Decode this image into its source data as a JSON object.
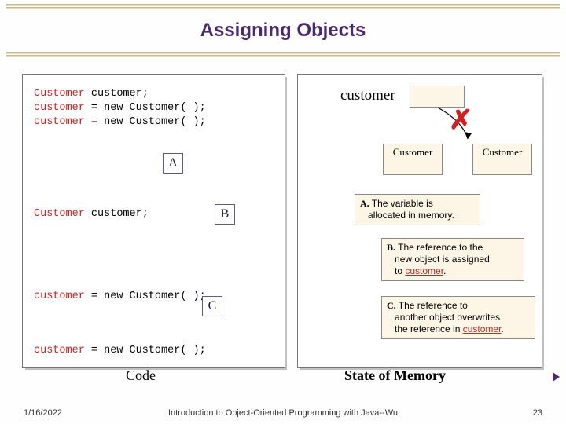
{
  "title": "Assigning Objects",
  "code_top": {
    "l1a": "Customer",
    "l1b": " customer;",
    "l2a": "customer",
    "l2b": " = new Customer( );",
    "l3a": "customer",
    "l3b": " = new Customer( );"
  },
  "badges": {
    "a": "A",
    "b": "B",
    "c": "C"
  },
  "code_bottom": {
    "l1a": "Customer",
    "l1b": " customer;",
    "l2a": "customer",
    "l2b": " = new Customer( );",
    "l3a": "customer",
    "l3b": " = new Customer( );"
  },
  "memory": {
    "var_label": "customer",
    "obj1": "Customer",
    "obj2": "Customer"
  },
  "explain": {
    "a_tag": "A.",
    "a_text1": " The variable is",
    "a_text2": "allocated in memory.",
    "b_tag": "B.",
    "b_text1": " The reference to the",
    "b_text2": "new object is assigned",
    "b_text3_pre": "to ",
    "b_text3_u": "customer",
    "b_text3_post": ".",
    "c_tag": "C.",
    "c_text1": " The reference to",
    "c_text2": "another object overwrites",
    "c_text3_pre": "the reference in ",
    "c_text3_u": "customer",
    "c_text3_post": "."
  },
  "footer": {
    "code": "Code",
    "state": "State of Memory"
  },
  "bottom": {
    "date": "1/16/2022",
    "mid": "Introduction to Object-Oriented Programming with Java--Wu",
    "page": "23"
  }
}
